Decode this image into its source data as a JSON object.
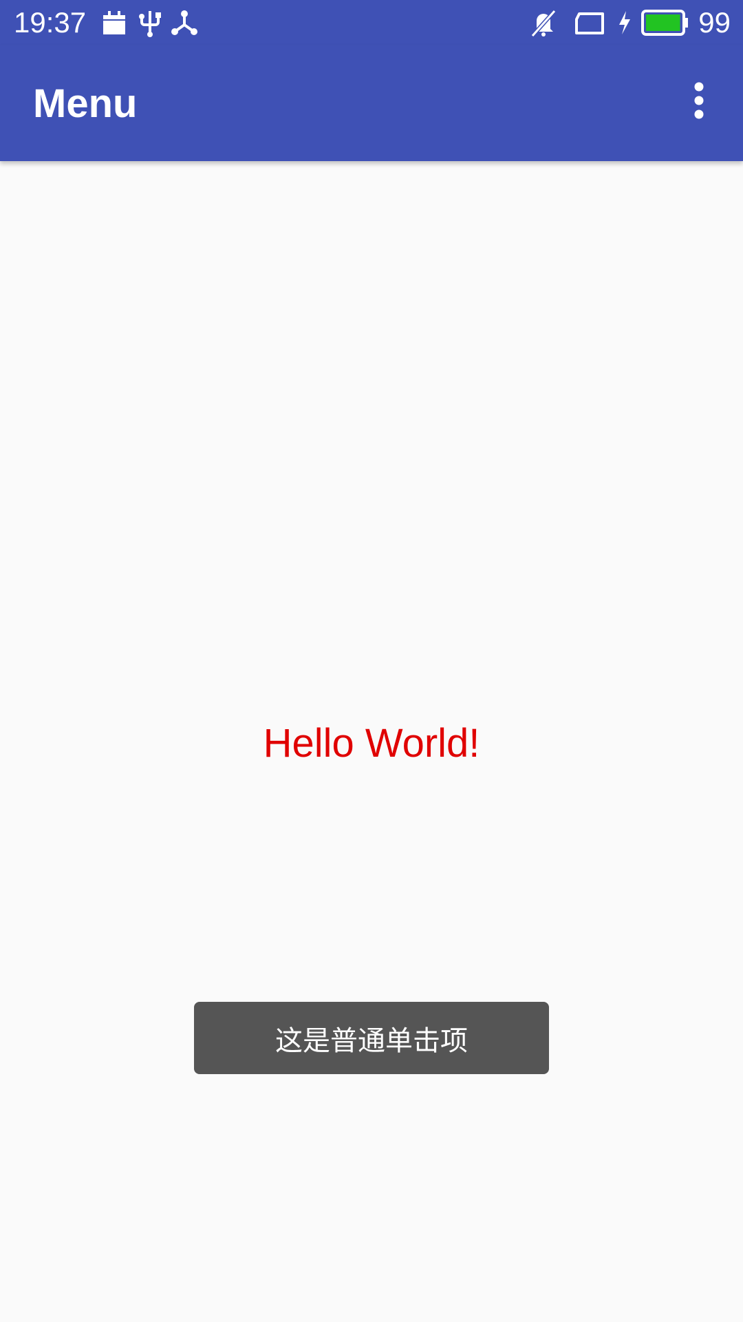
{
  "status_bar": {
    "time": "19:37",
    "battery_level": "99",
    "icons": [
      "calendar-icon",
      "usb-icon",
      "share-icon",
      "notifications-off-icon",
      "tablet-icon",
      "charging-icon",
      "battery-icon"
    ],
    "battery_fill_percent": 99,
    "battery_color": "#22c322"
  },
  "app_bar": {
    "title": "Menu",
    "overflow_icon": "more-vert-icon",
    "color": "#3f51b5"
  },
  "main": {
    "text": "Hello World!",
    "text_color": "#e00000"
  },
  "toast": {
    "message": "这是普通单击项"
  }
}
